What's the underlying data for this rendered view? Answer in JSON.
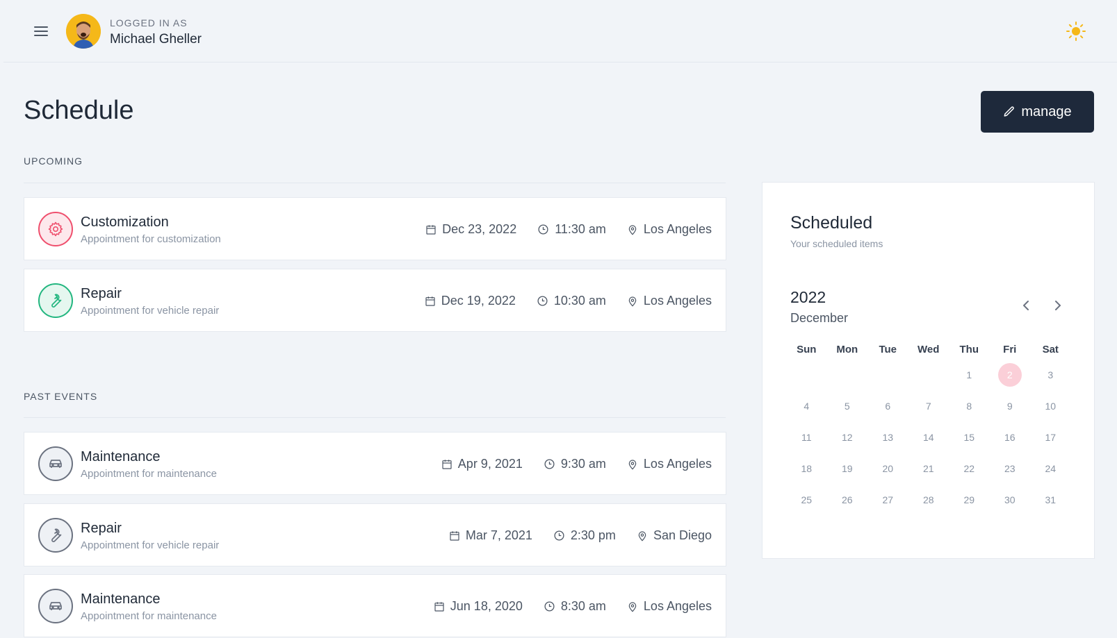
{
  "topbar": {
    "logged_in_label": "LOGGED IN AS",
    "user_name": "Michael Gheller"
  },
  "page": {
    "title": "Schedule",
    "manage_label": "manage"
  },
  "upcoming": {
    "label": "UPCOMING",
    "events": [
      {
        "title": "Customization",
        "subtitle": "Appointment for customization",
        "date": "Dec 23, 2022",
        "time": "11:30 am",
        "location": "Los Angeles",
        "icon": "gear-icon",
        "color": "#ef4f6d"
      },
      {
        "title": "Repair",
        "subtitle": "Appointment for vehicle repair",
        "date": "Dec 19, 2022",
        "time": "10:30 am",
        "location": "Los Angeles",
        "icon": "wrench-icon",
        "color": "#22b67f"
      }
    ]
  },
  "past": {
    "label": "PAST EVENTS",
    "events": [
      {
        "title": "Maintenance",
        "subtitle": "Appointment for maintenance",
        "date": "Apr 9, 2021",
        "time": "9:30 am",
        "location": "Los Angeles",
        "icon": "car-icon",
        "color": "#6b7280"
      },
      {
        "title": "Repair",
        "subtitle": "Appointment for vehicle repair",
        "date": "Mar 7, 2021",
        "time": "2:30 pm",
        "location": "San Diego",
        "icon": "wrench-icon",
        "color": "#6b7280"
      },
      {
        "title": "Maintenance",
        "subtitle": "Appointment for maintenance",
        "date": "Jun 18, 2020",
        "time": "8:30 am",
        "location": "Los Angeles",
        "icon": "car-icon",
        "color": "#6b7280"
      }
    ]
  },
  "calendar": {
    "title": "Scheduled",
    "subtitle": "Your scheduled items",
    "year": "2022",
    "month": "December",
    "weekdays": [
      "Sun",
      "Mon",
      "Tue",
      "Wed",
      "Thu",
      "Fri",
      "Sat"
    ],
    "weeks": [
      [
        "",
        "",
        "",
        "",
        "1",
        "2",
        "3"
      ],
      [
        "4",
        "5",
        "6",
        "7",
        "8",
        "9",
        "10"
      ],
      [
        "11",
        "12",
        "13",
        "14",
        "15",
        "16",
        "17"
      ],
      [
        "18",
        "19",
        "20",
        "21",
        "22",
        "23",
        "24"
      ],
      [
        "25",
        "26",
        "27",
        "28",
        "29",
        "30",
        "31"
      ]
    ],
    "selected_day": "2"
  },
  "colors": {
    "accent_dark": "#1e293b",
    "sun": "#f5b819",
    "selected_day_bg": "#fbcfd8"
  }
}
